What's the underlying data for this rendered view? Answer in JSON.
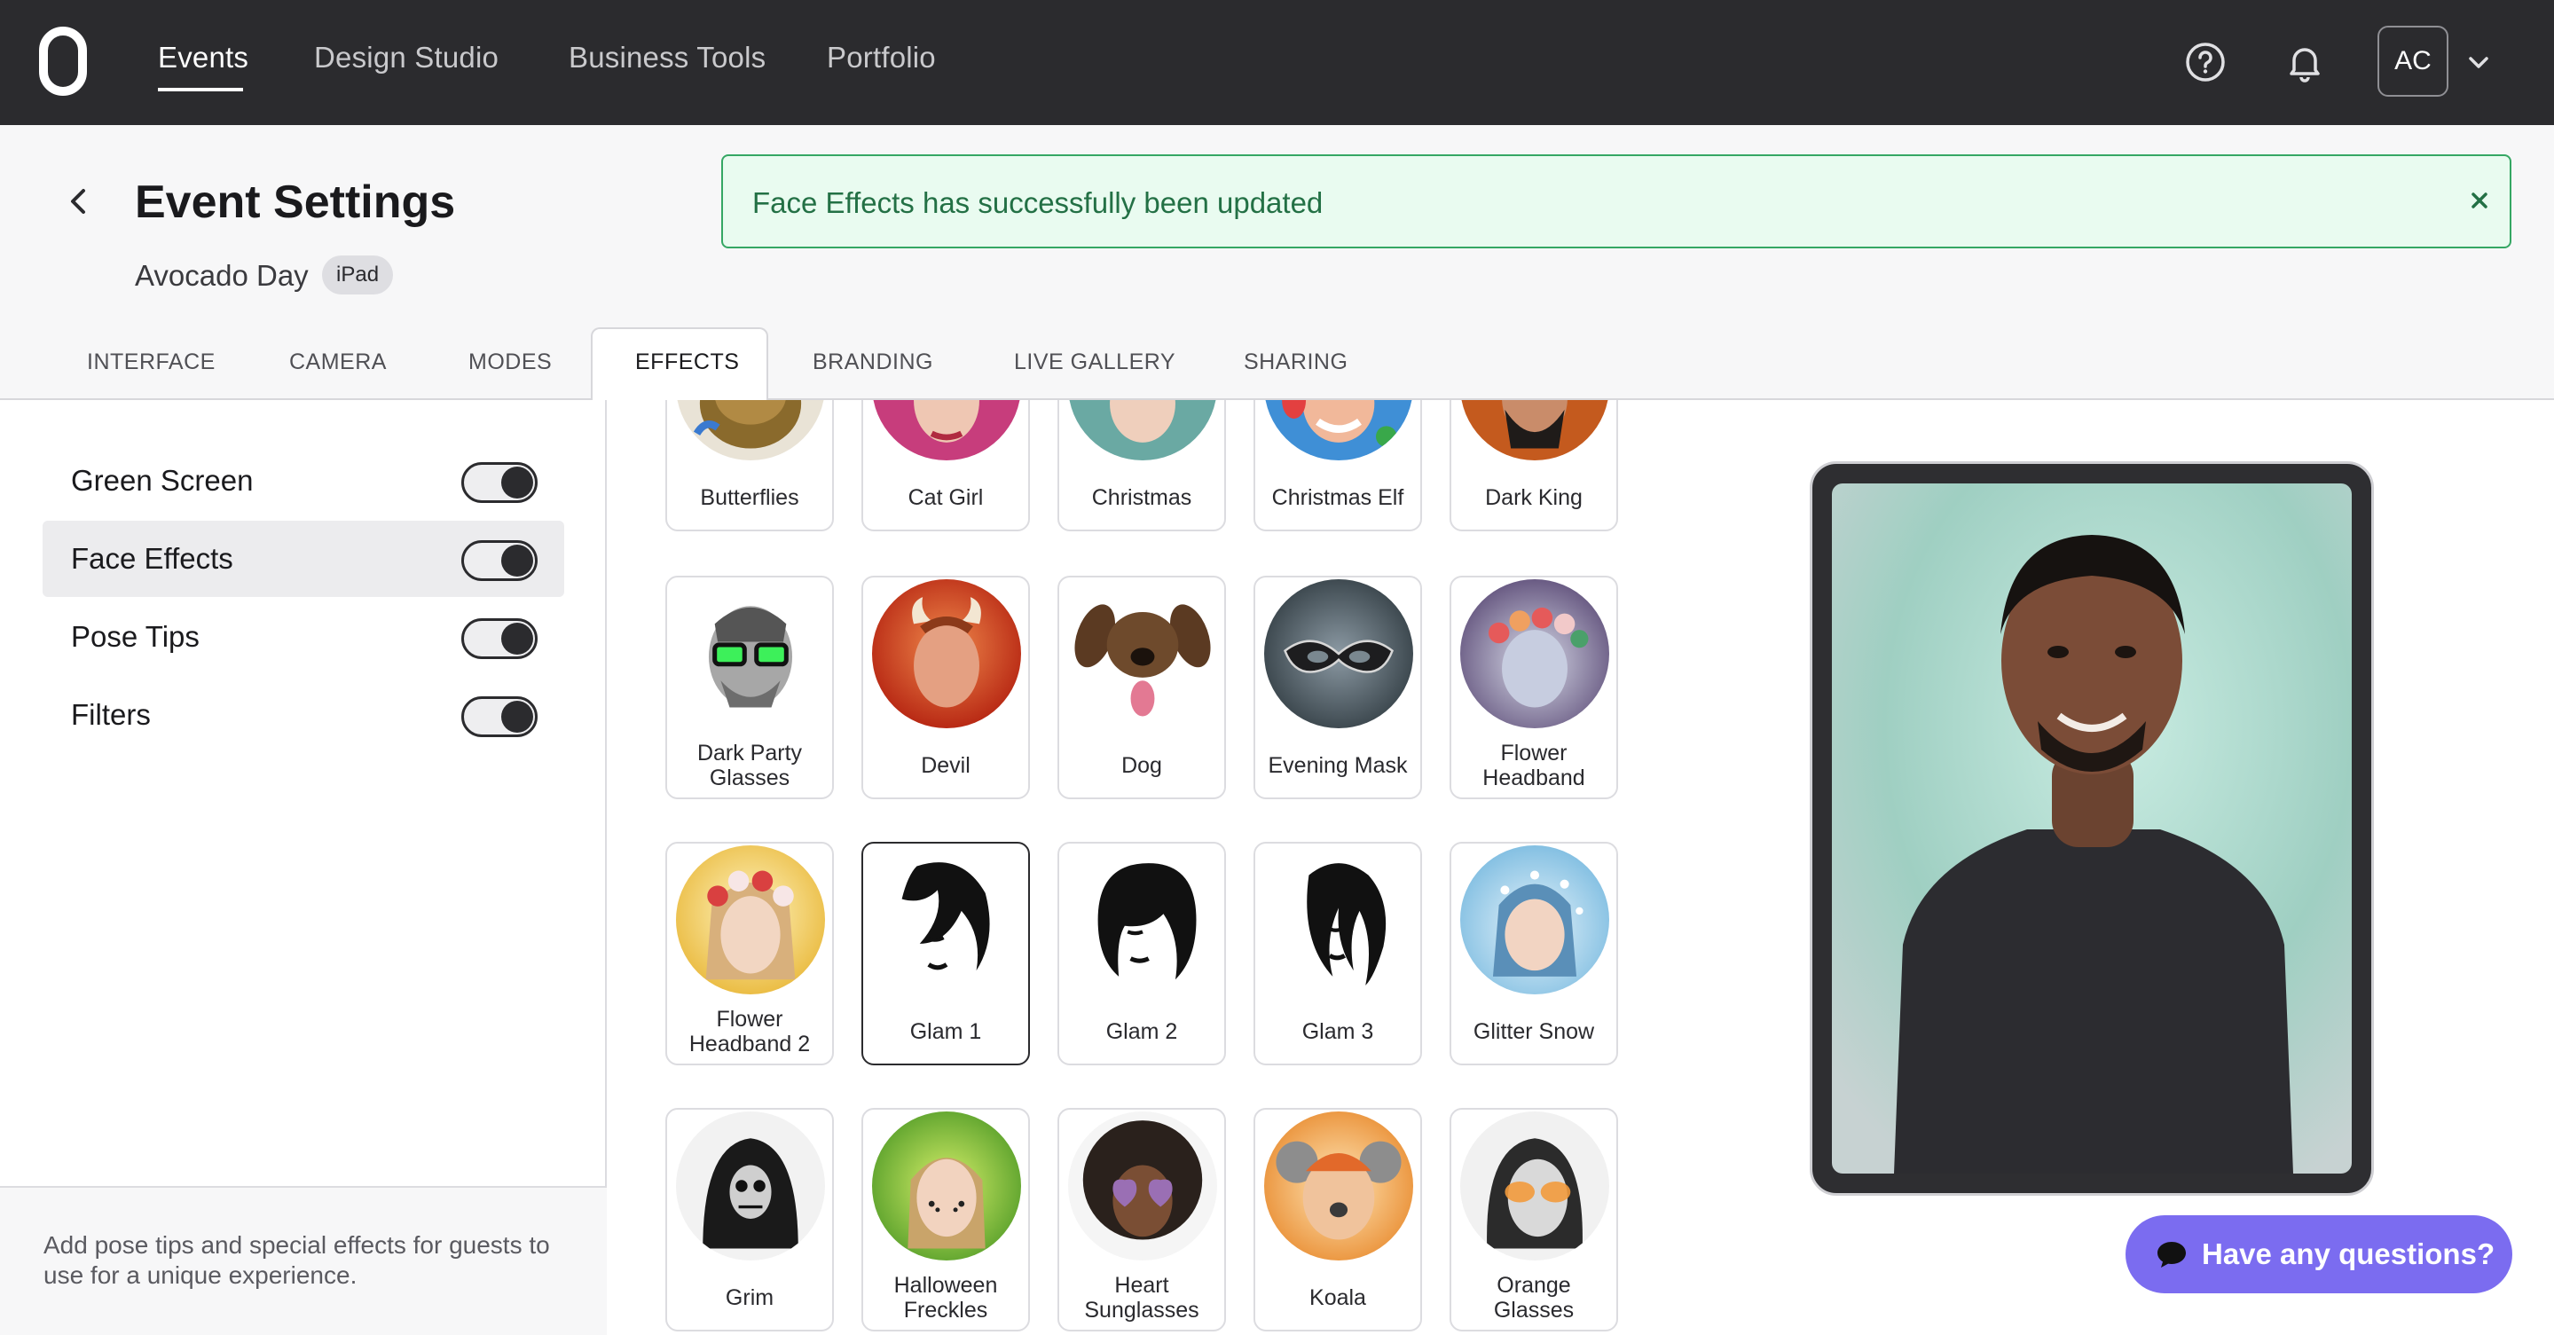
{
  "nav": {
    "items": [
      "Events",
      "Design Studio",
      "Business Tools",
      "Portfolio"
    ],
    "avatar_initials": "AC"
  },
  "header": {
    "title": "Event Settings",
    "event_name": "Avocado Day",
    "device_badge": "iPad"
  },
  "toast": {
    "message": "Face Effects has successfully been updated"
  },
  "tabs": [
    "INTERFACE",
    "CAMERA",
    "MODES",
    "EFFECTS",
    "BRANDING",
    "LIVE GALLERY",
    "SHARING"
  ],
  "features": [
    {
      "label": "Green Screen",
      "enabled": true
    },
    {
      "label": "Face Effects",
      "enabled": true
    },
    {
      "label": "Pose Tips",
      "enabled": true
    },
    {
      "label": "Filters",
      "enabled": true
    }
  ],
  "helper_text": "Add pose tips and special effects for guests to use for a unique experience.",
  "effects": [
    {
      "label": "Butterflies"
    },
    {
      "label": "Cat Girl"
    },
    {
      "label": "Christmas"
    },
    {
      "label": "Christmas Elf"
    },
    {
      "label": "Dark King"
    },
    {
      "label": "Dark Party Glasses"
    },
    {
      "label": "Devil"
    },
    {
      "label": "Dog"
    },
    {
      "label": "Evening Mask"
    },
    {
      "label": "Flower Headband"
    },
    {
      "label": "Flower Headband 2"
    },
    {
      "label": "Glam 1"
    },
    {
      "label": "Glam 2"
    },
    {
      "label": "Glam 3"
    },
    {
      "label": "Glitter Snow"
    },
    {
      "label": "Grim"
    },
    {
      "label": "Halloween Freckles"
    },
    {
      "label": "Heart Sunglasses"
    },
    {
      "label": "Koala"
    },
    {
      "label": "Orange Glasses"
    }
  ],
  "chat": {
    "label": "Have any questions?"
  },
  "colors": {
    "nav_bg": "#2b2b2e",
    "toast_bg": "#e9fbf0",
    "toast_border": "#35a764",
    "chat_bg": "#7b6cf0"
  }
}
